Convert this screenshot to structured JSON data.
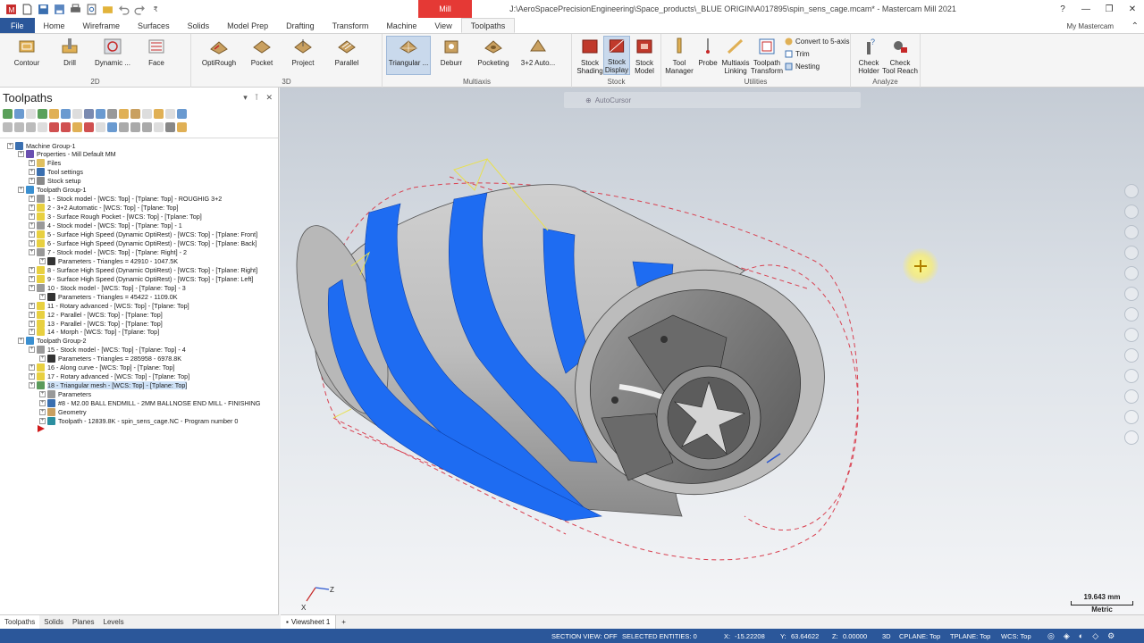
{
  "title_bar": {
    "context_tab": "Mill",
    "window_title": "J:\\AeroSpacePrecisionEngineering\\Space_products\\_BLUE ORIGIN\\A017895\\spin_sens_cage.mcam* - Mastercam Mill 2021",
    "qat_more": "₹"
  },
  "menu": {
    "tabs": [
      "File",
      "Home",
      "Wireframe",
      "Surfaces",
      "Solids",
      "Model Prep",
      "Drafting",
      "Transform",
      "Machine",
      "View",
      "Toolpaths"
    ],
    "active": "Toolpaths",
    "my_mastercam": "My Mastercam"
  },
  "ribbon": {
    "groups": {
      "g2d": "2D",
      "g3d": "3D",
      "multiaxis": "Multiaxis",
      "stock": "Stock",
      "utilities": "Utilities",
      "analyze": "Analyze"
    },
    "buttons": {
      "contour": "Contour",
      "drill": "Drill",
      "dynamic": "Dynamic ...",
      "face": "Face",
      "optirough": "OptiRough",
      "pocket": "Pocket",
      "project": "Project",
      "parallel": "Parallel",
      "triangular": "Triangular ...",
      "deburr": "Deburr",
      "pocketing": "Pocketing",
      "auto32": "3+2 Auto...",
      "stock_shading_1": "Stock",
      "stock_shading_2": "Shading",
      "stock_display_1": "Stock",
      "stock_display_2": "Display",
      "stock_model_1": "Stock",
      "stock_model_2": "Model",
      "tool_manager_1": "Tool",
      "tool_manager_2": "Manager",
      "probe": "Probe",
      "multiaxis_linking_1": "Multiaxis",
      "multiaxis_linking_2": "Linking",
      "toolpath_transform_1": "Toolpath",
      "toolpath_transform_2": "Transform",
      "convert_5axis": "Convert to 5-axis",
      "trim": "Trim",
      "nesting": "Nesting",
      "check_holder_1": "Check",
      "check_holder_2": "Holder",
      "check_tool_reach_1": "Check",
      "check_tool_reach_2": "Tool Reach"
    }
  },
  "panel": {
    "title": "Toolpaths",
    "tree": [
      {
        "label": "Machine Group-1",
        "icon": "machine-group"
      },
      {
        "label": "Properties - Mill Default MM",
        "icon": "properties"
      },
      {
        "label": "Files",
        "icon": "folder"
      },
      {
        "label": "Tool settings",
        "icon": "tool-settings"
      },
      {
        "label": "Stock setup",
        "icon": "stock-setup"
      },
      {
        "label": "Toolpath Group-1",
        "icon": "toolpath-group"
      },
      {
        "label": "1 - Stock model - [WCS: Top] - [Tplane: Top] - ROUGHIG 3+2",
        "icon": "stock-model"
      },
      {
        "label": "2 - 3+2 Automatic - [WCS: Top] - [Tplane: Top]",
        "icon": "operation"
      },
      {
        "label": "3 - Surface Rough Pocket - [WCS: Top] - [Tplane: Top]",
        "icon": "operation"
      },
      {
        "label": "4 - Stock model - [WCS: Top] - [Tplane: Top] - 1",
        "icon": "stock-model"
      },
      {
        "label": "5 - Surface High Speed (Dynamic OptiRest) - [WCS: Top] - [Tplane: Front]",
        "icon": "operation"
      },
      {
        "label": "6 - Surface High Speed (Dynamic OptiRest) - [WCS: Top] - [Tplane: Back]",
        "icon": "operation"
      },
      {
        "label": "7 - Stock model - [WCS: Top] - [Tplane: Right] - 2",
        "icon": "stock-model"
      },
      {
        "label": "Parameters - Triangles = 42910 - 1047.5K",
        "icon": "mesh"
      },
      {
        "label": "8 - Surface High Speed (Dynamic OptiRest) - [WCS: Top] - [Tplane: Right]",
        "icon": "operation"
      },
      {
        "label": "9 - Surface High Speed (Dynamic OptiRest) - [WCS: Top] - [Tplane: Left]",
        "icon": "operation"
      },
      {
        "label": "10 - Stock model - [WCS: Top] - [Tplane: Top] - 3",
        "icon": "stock-model"
      },
      {
        "label": "Parameters - Triangles = 45422 - 1109.0K",
        "icon": "mesh"
      },
      {
        "label": "11 - Rotary advanced - [WCS: Top] - [Tplane: Top]",
        "icon": "operation"
      },
      {
        "label": "12 - Parallel - [WCS: Top] - [Tplane: Top]",
        "icon": "operation"
      },
      {
        "label": "13 - Parallel - [WCS: Top] - [Tplane: Top]",
        "icon": "operation"
      },
      {
        "label": "14 - Morph - [WCS: Top] - [Tplane: Top]",
        "icon": "operation"
      },
      {
        "label": "Toolpath Group-2",
        "icon": "toolpath-group"
      },
      {
        "label": "15 - Stock model - [WCS: Top] - [Tplane: Top] - 4",
        "icon": "stock-model"
      },
      {
        "label": "Parameters - Triangles = 285958 - 6978.8K",
        "icon": "mesh"
      },
      {
        "label": "16 - Along curve - [WCS: Top] - [Tplane: Top]",
        "icon": "operation"
      },
      {
        "label": "17 - Rotary advanced - [WCS: Top] - [Tplane: Top]",
        "icon": "operation"
      },
      {
        "label": "18 - Triangular mesh - [WCS: Top] - [Tplane: Top]",
        "icon": "operation-selected"
      },
      {
        "label": "Parameters",
        "icon": "parameters"
      },
      {
        "label": "#8 - M2.00 BALL ENDMILL - 2MM BALLNOSE END MILL - FINISHING",
        "icon": "tool"
      },
      {
        "label": "Geometry",
        "icon": "geometry"
      },
      {
        "label": "Toolpath - 12839.8K - spin_sens_cage.NC - Program number 0",
        "icon": "toolpath"
      }
    ]
  },
  "bottom_tabs": [
    "Toolpaths",
    "Solids",
    "Planes",
    "Levels"
  ],
  "viewsheet": {
    "label": "Viewsheet 1",
    "add": "+"
  },
  "viewport": {
    "autocursor": "AutoCursor",
    "scale_value": "19.643 mm",
    "scale_unit": "Metric",
    "axis_x": "X",
    "axis_z": "Z"
  },
  "status": {
    "section_view": "SECTION VIEW: OFF",
    "selected": "SELECTED ENTITIES: 0",
    "x_label": "X:",
    "x_value": "-15.22208",
    "y_label": "Y:",
    "y_value": "63.64622",
    "z_label": "Z:",
    "z_value": "0.00000",
    "mode": "3D",
    "cplane": "CPLANE: Top",
    "tplane": "TPLANE: Top",
    "wcs": "WCS: Top"
  },
  "colors": {
    "accent": "#2b579a",
    "context": "#e53935",
    "stock_blue": "#1e6cf2",
    "part_gray": "#a8a8a8"
  }
}
